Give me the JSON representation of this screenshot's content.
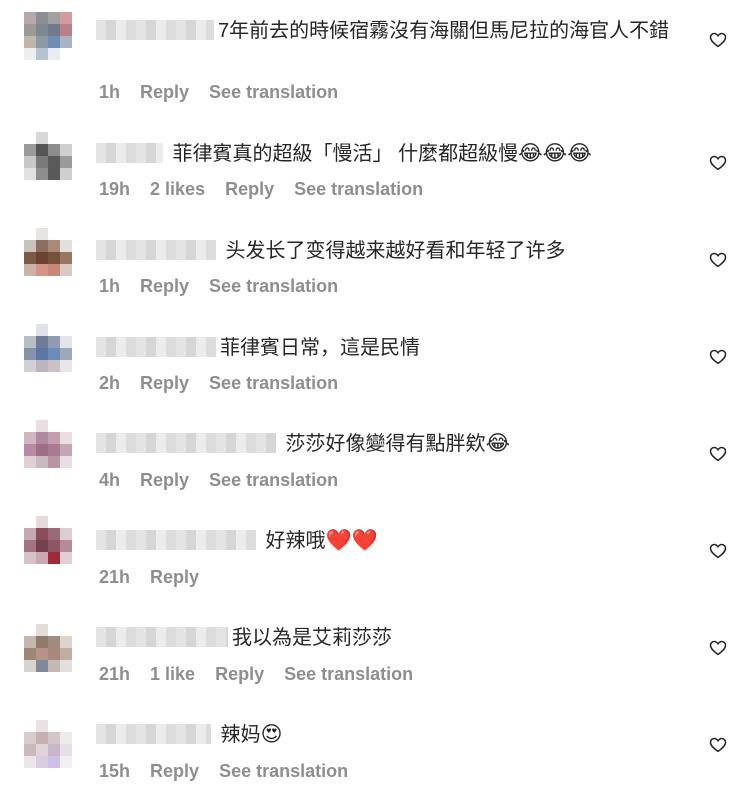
{
  "comments": [
    {
      "text": "7年前去的時候宿霧沒有海關但馬尼拉的海官人不錯",
      "emoji": "",
      "time": "1h",
      "likes": "",
      "reply_label": "Reply",
      "translation_label": "See translation"
    },
    {
      "text": " 菲律賓真的超級「慢活」 什麼都超級慢",
      "emoji": "😂😂😂",
      "time": "19h",
      "likes": "2 likes",
      "reply_label": "Reply",
      "translation_label": "See translation"
    },
    {
      "text": " 头发长了变得越来越好看和年轻了许多",
      "emoji": "",
      "time": "1h",
      "likes": "",
      "reply_label": "Reply",
      "translation_label": "See translation"
    },
    {
      "text": "菲律賓日常，這是民情",
      "emoji": "",
      "time": "2h",
      "likes": "",
      "reply_label": "Reply",
      "translation_label": "See translation"
    },
    {
      "text": " 莎莎好像變得有點胖欸",
      "emoji": "😂",
      "time": "4h",
      "likes": "",
      "reply_label": "Reply",
      "translation_label": "See translation"
    },
    {
      "text": " 好辣哦",
      "emoji": "❤️❤️",
      "time": "21h",
      "likes": "",
      "reply_label": "Reply",
      "translation_label": ""
    },
    {
      "text": "我以為是艾莉莎莎",
      "emoji": "",
      "time": "21h",
      "likes": "1 like",
      "reply_label": "Reply",
      "translation_label": "See translation"
    },
    {
      "text": " 辣妈",
      "emoji": "😍",
      "time": "15h",
      "likes": "",
      "reply_label": "Reply",
      "translation_label": "See translation"
    }
  ],
  "icons": {
    "like": "heart-outline-icon",
    "avatar": "blurred-avatar"
  },
  "colors": {
    "text": "#262626",
    "meta": "#8e8e8e",
    "background": "#ffffff",
    "heart_stroke": "#262626"
  }
}
